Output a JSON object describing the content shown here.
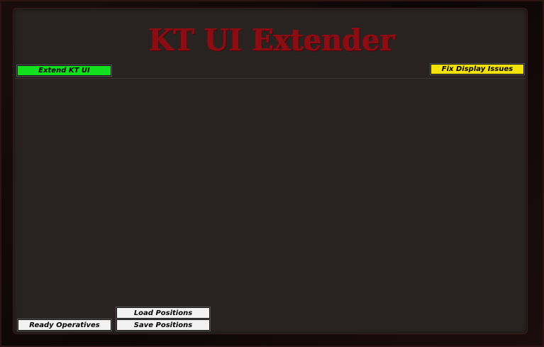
{
  "header": {
    "title": "KT UI Extender"
  },
  "toolbar": {
    "extend_label": "Extend KT UI",
    "fix_display_label": "Fix Display Issues"
  },
  "footer": {
    "ready_operatives_label": "Ready Operatives",
    "load_positions_label": "Load Positions",
    "save_positions_label": "Save Positions"
  },
  "colors": {
    "title": "#8a0d14",
    "panel_background": "#282220",
    "extend_button": "#12e01e",
    "fix_display_button": "#f5e20a",
    "footer_buttons": "#f2f2f2"
  }
}
